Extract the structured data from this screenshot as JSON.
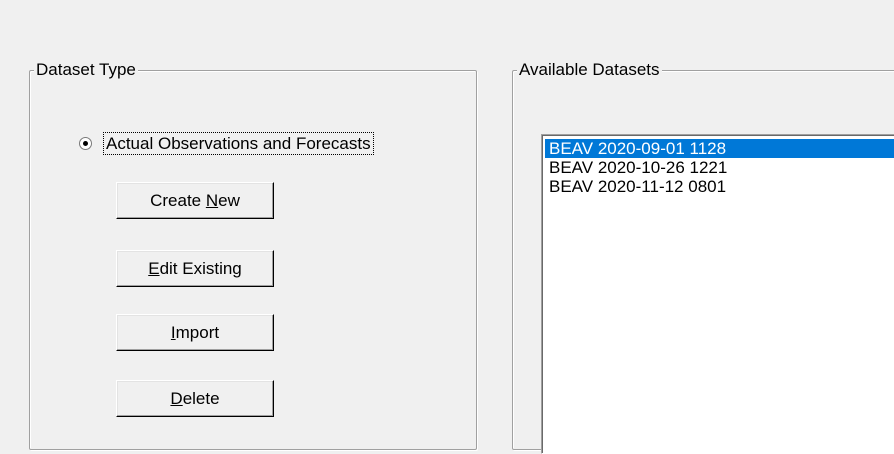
{
  "dataset_type": {
    "legend": "Dataset Type",
    "radio_option": {
      "label": "Actual Observations and Forecasts",
      "selected": true
    },
    "buttons": {
      "create_new": {
        "pre": "Create ",
        "mnemonic": "N",
        "post": "ew"
      },
      "edit_existing": {
        "pre": "",
        "mnemonic": "E",
        "post": "dit Existing"
      },
      "import": {
        "pre": "",
        "mnemonic": "I",
        "post": "mport"
      },
      "delete": {
        "pre": "",
        "mnemonic": "D",
        "post": "elete"
      }
    }
  },
  "available_datasets": {
    "legend": "Available Datasets",
    "items": [
      {
        "label": "BEAV 2020-09-01 1128",
        "selected": true
      },
      {
        "label": "BEAV 2020-10-26 1221",
        "selected": false
      },
      {
        "label": "BEAV 2020-11-12 0801",
        "selected": false
      }
    ]
  },
  "colors": {
    "selection": "#0078d7",
    "face": "#f0f0f0"
  }
}
